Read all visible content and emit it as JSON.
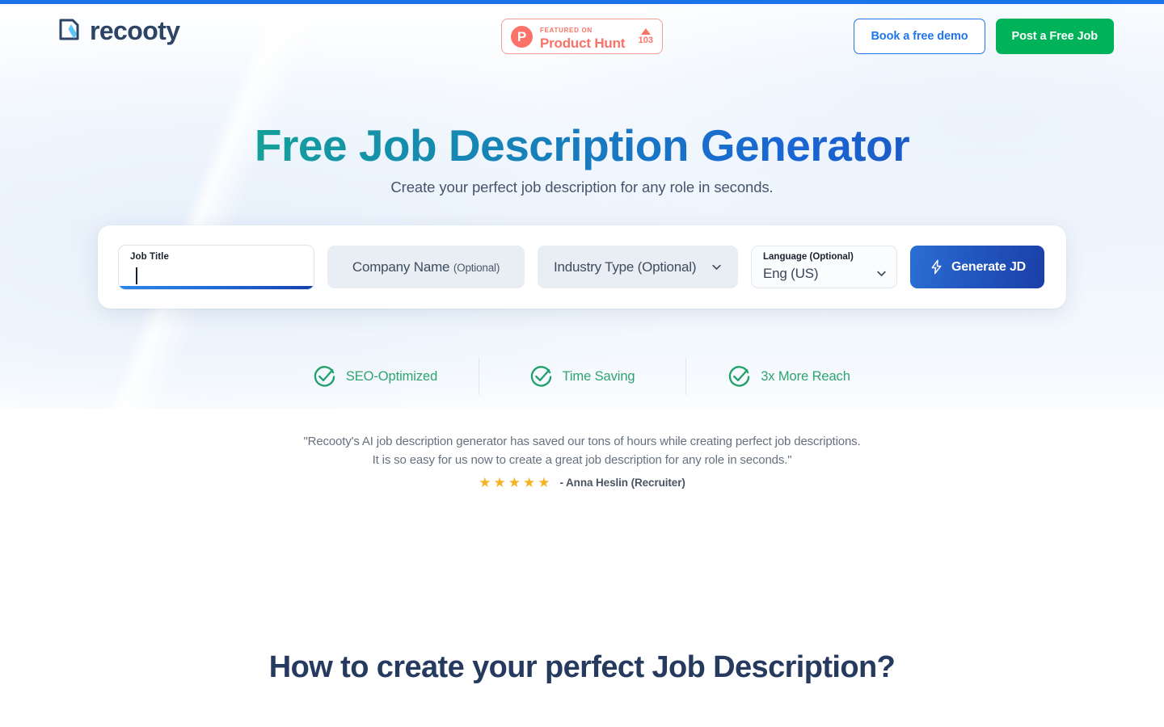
{
  "theme": {
    "accent_blue": "#1a73e8",
    "brand_navy": "#2c4465",
    "green": "#00b259",
    "product_hunt_coral": "#fa7268",
    "star_gold": "#f5b324",
    "feature_green": "#2ea36f"
  },
  "header": {
    "logo_text": "recooty",
    "logo_icon": "document-pen-icon",
    "product_hunt": {
      "icon": "product-hunt-icon",
      "badge_letter": "P",
      "featured_label": "FEATURED ON",
      "name": "Product Hunt",
      "upvote_icon": "caret-up-icon",
      "votes": "103"
    },
    "buttons": {
      "demo": "Book a free demo",
      "post_job": "Post a Free Job"
    }
  },
  "hero": {
    "title": "Free Job Description Generator",
    "subtitle": "Create your perfect job description for any role in seconds."
  },
  "form": {
    "job_title": {
      "label": "Job Title",
      "value": "",
      "focused": true
    },
    "company": {
      "placeholder": "Company Name",
      "optional_suffix": "(Optional)",
      "value": ""
    },
    "industry": {
      "placeholder": "Industry Type (Optional)",
      "value": "",
      "chevron_icon": "chevron-down-icon"
    },
    "language": {
      "label": "Language (Optional)",
      "value": "Eng (US)",
      "chevron_icon": "chevron-down-icon"
    },
    "generate_button": {
      "label": "Generate JD",
      "icon": "lightning-bolt-icon"
    }
  },
  "features": [
    {
      "icon": "check-circle-icon",
      "label": "SEO-Optimized"
    },
    {
      "icon": "check-circle-icon",
      "label": "Time Saving"
    },
    {
      "icon": "check-circle-icon",
      "label": "3x More Reach"
    }
  ],
  "testimonial": {
    "line1": "\"Recooty's AI job description generator has saved our tons of hours while creating perfect job descriptions.",
    "line2": "It is so easy for us now to create a great job description for any role in seconds.\"",
    "stars": "5",
    "author": "- Anna Heslin (Recruiter)"
  },
  "howto": {
    "heading": "How to create your perfect Job Description?"
  }
}
